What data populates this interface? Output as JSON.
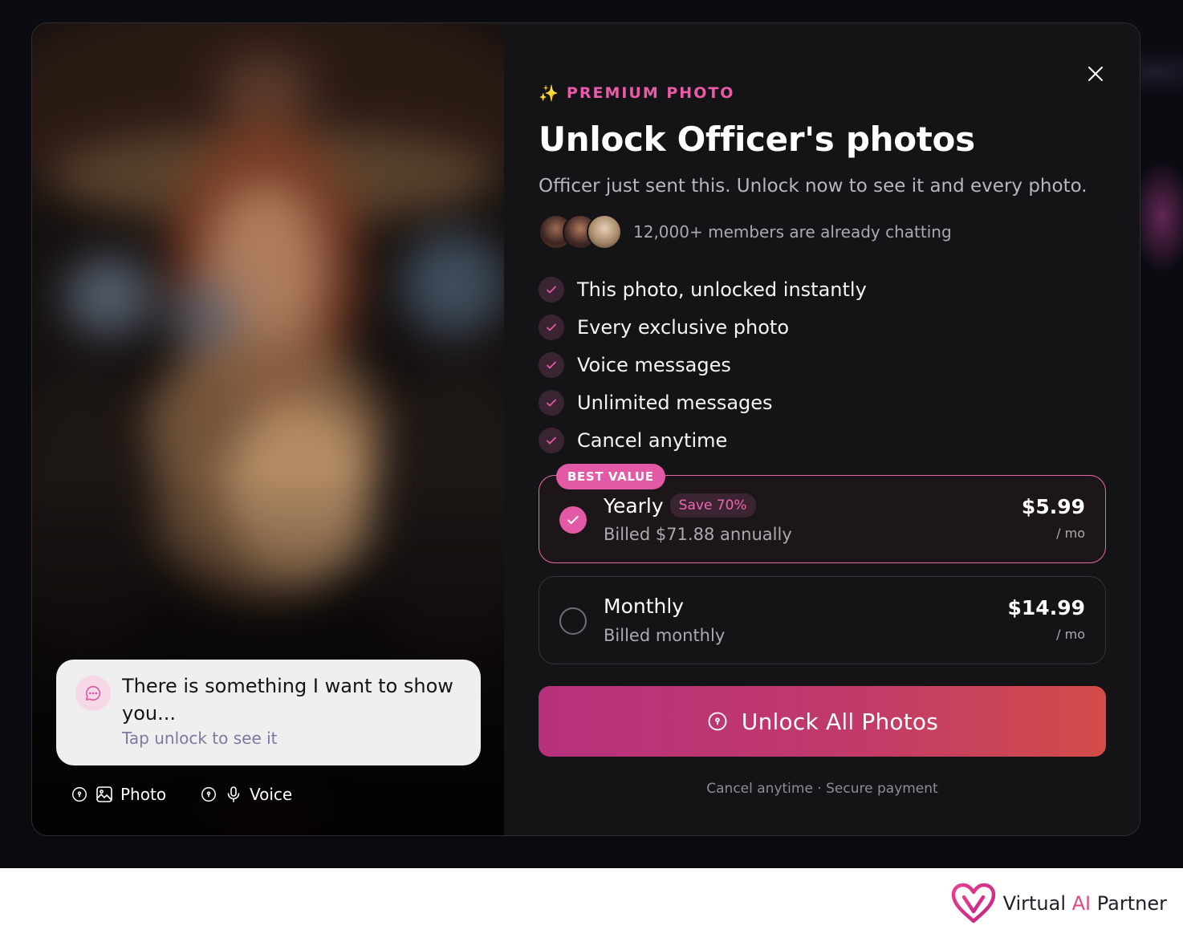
{
  "modal": {
    "eyebrow": "PREMIUM PHOTO",
    "title": "Unlock Officer's photos",
    "subtitle": "Officer just sent this. Unlock now to see it and every photo.",
    "social_proof": "12,000+ members are already chatting",
    "features": [
      "This photo, unlocked instantly",
      "Every exclusive photo",
      "Voice messages",
      "Unlimited messages",
      "Cancel anytime"
    ],
    "plans": [
      {
        "badge": "BEST VALUE",
        "name": "Yearly",
        "save_badge": "Save 70%",
        "billing": "Billed $71.88 annually",
        "price": "$5.99",
        "unit": "/ mo",
        "selected": true
      },
      {
        "name": "Monthly",
        "billing": "Billed monthly",
        "price": "$14.99",
        "unit": "/ mo",
        "selected": false
      }
    ],
    "cta_label": "Unlock All Photos",
    "fine_print": "Cancel anytime · Secure payment"
  },
  "photo_panel": {
    "message": "There is something I want to show you...",
    "message_sub": "Tap unlock to see it",
    "chips": [
      {
        "label": "Photo",
        "icon": "image-icon"
      },
      {
        "label": "Voice",
        "icon": "microphone-icon"
      }
    ]
  },
  "brand": {
    "name_prefix": "Virtual ",
    "name_highlight": "AI",
    "name_suffix": " Partner"
  },
  "colors": {
    "accent": "#e25aa6",
    "cta_start": "#b6307d",
    "cta_end": "#d24c48",
    "panel": "#141416"
  }
}
